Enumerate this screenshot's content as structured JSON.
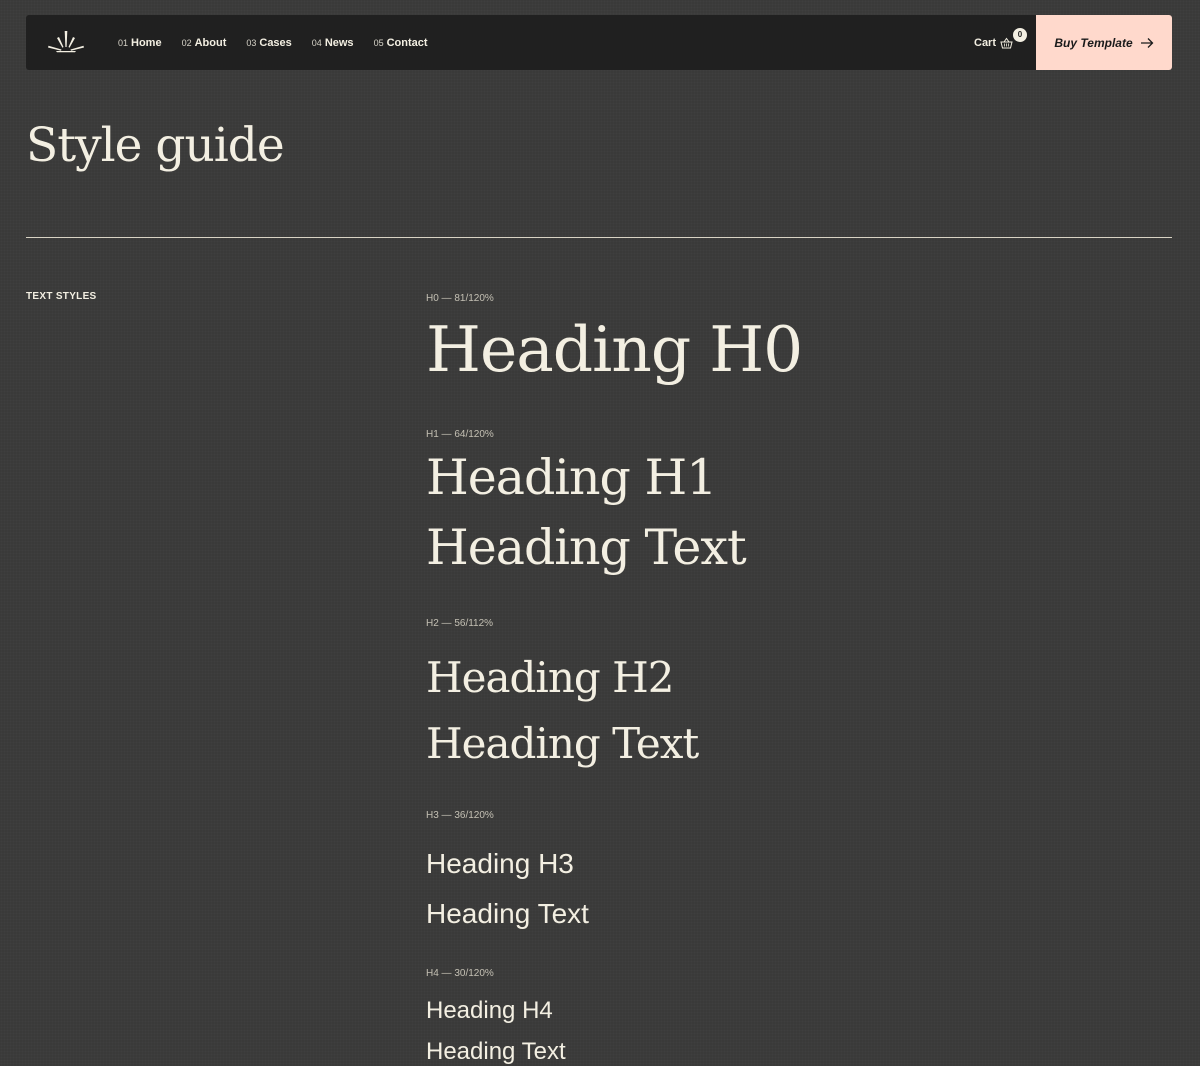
{
  "nav": {
    "links": [
      {
        "num": "01",
        "label": "Home"
      },
      {
        "num": "02",
        "label": "About"
      },
      {
        "num": "03",
        "label": "Cases"
      },
      {
        "num": "04",
        "label": "News"
      },
      {
        "num": "05",
        "label": "Contact"
      }
    ],
    "cart_label": "Cart",
    "cart_count": "0",
    "buy_label": "Buy Template"
  },
  "page": {
    "title": "Style guide",
    "section_label": "TEXT STYLES"
  },
  "styles": {
    "h0": {
      "spec": "H0 — 81/120%",
      "lines": [
        "Heading H0"
      ]
    },
    "h1": {
      "spec": "H1 — 64/120%",
      "lines": [
        "Heading H1",
        "Heading Text"
      ]
    },
    "h2": {
      "spec": "H2 — 56/112%",
      "lines": [
        "Heading H2",
        "Heading Text"
      ]
    },
    "h3": {
      "spec": "H3 — 36/120%",
      "lines": [
        "Heading H3",
        "Heading Text"
      ]
    },
    "h4": {
      "spec": "H4 — 30/120%",
      "lines": [
        "Heading H4",
        "Heading Text"
      ]
    }
  },
  "colors": {
    "background": "#3a3a39",
    "navbar": "#202020",
    "text": "#f3efe2",
    "accent": "#ffd9cc"
  },
  "icons": {
    "logo": "burst-logo-icon",
    "cart": "basket-icon",
    "arrow": "arrow-right-icon"
  }
}
